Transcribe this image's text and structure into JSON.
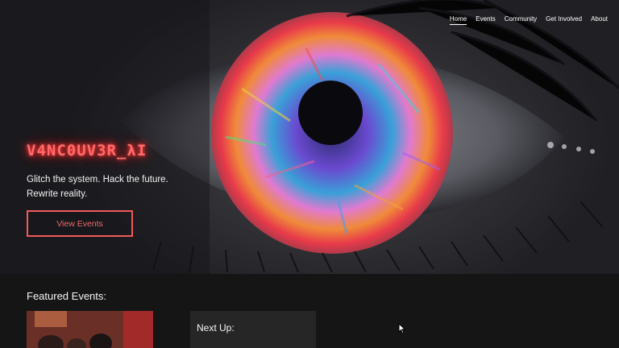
{
  "nav": {
    "items": [
      {
        "label": "Home",
        "active": true
      },
      {
        "label": "Events",
        "active": false
      },
      {
        "label": "Community",
        "active": false
      },
      {
        "label": "Get Involved",
        "active": false
      },
      {
        "label": "About",
        "active": false
      }
    ]
  },
  "hero": {
    "brand": "V4NC0UV3R_λI",
    "tagline": "Glitch the system. Hack the future. Rewrite reality.",
    "cta_label": "View Events"
  },
  "featured": {
    "title": "Featured Events:",
    "next_up": "Next Up:"
  },
  "colors": {
    "accent": "#ef5a5a",
    "brand_glow": "#ff3b3b",
    "background": "#141414"
  }
}
